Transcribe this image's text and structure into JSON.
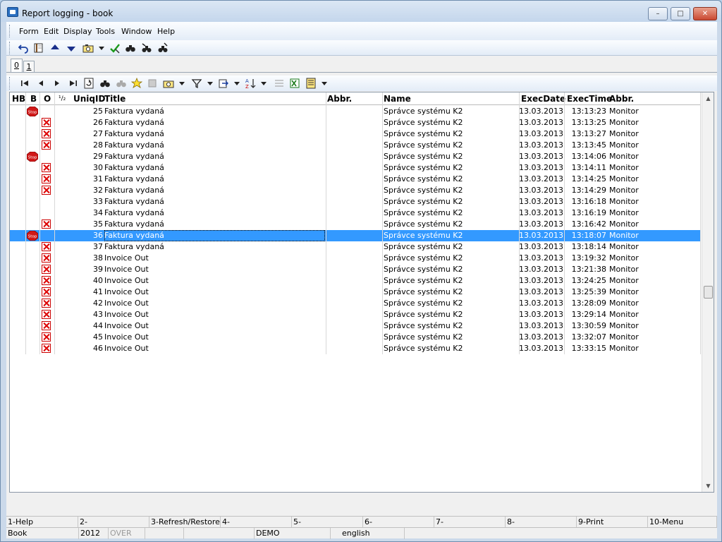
{
  "window": {
    "title": "Report logging - book",
    "min_symbol": "–",
    "max_symbol": "□",
    "close_symbol": "✕"
  },
  "menu": [
    "Form",
    "Edit",
    "Display",
    "Tools",
    "Window",
    "Help"
  ],
  "tabs": [
    "0",
    "1"
  ],
  "grid": {
    "headers": {
      "hb": "HB",
      "b": "B",
      "o": "O",
      "sort": "¹/₂",
      "uniqid": "UniqID",
      "title": "Title",
      "abbr": "Abbr.",
      "name": "Name",
      "execdate": "ExecDate",
      "exectime": "ExecTime",
      "abbr2": "Abbr."
    },
    "rows": [
      {
        "b": "stop",
        "o": "",
        "id": "25",
        "title": "Faktura vydaná",
        "name": "Správce systému K2",
        "date": "13.03.2013",
        "time": "13:13:23",
        "abbr2": "Monitor"
      },
      {
        "b": "",
        "o": "x",
        "id": "26",
        "title": "Faktura vydaná",
        "name": "Správce systému K2",
        "date": "13.03.2013",
        "time": "13:13:25",
        "abbr2": "Monitor"
      },
      {
        "b": "",
        "o": "x",
        "id": "27",
        "title": "Faktura vydaná",
        "name": "Správce systému K2",
        "date": "13.03.2013",
        "time": "13:13:27",
        "abbr2": "Monitor"
      },
      {
        "b": "",
        "o": "x",
        "id": "28",
        "title": "Faktura vydaná",
        "name": "Správce systému K2",
        "date": "13.03.2013",
        "time": "13:13:45",
        "abbr2": "Monitor"
      },
      {
        "b": "stop",
        "o": "",
        "id": "29",
        "title": "Faktura vydaná",
        "name": "Správce systému K2",
        "date": "13.03.2013",
        "time": "13:14:06",
        "abbr2": "Monitor"
      },
      {
        "b": "",
        "o": "x",
        "id": "30",
        "title": "Faktura vydaná",
        "name": "Správce systému K2",
        "date": "13.03.2013",
        "time": "13:14:11",
        "abbr2": "Monitor"
      },
      {
        "b": "",
        "o": "x",
        "id": "31",
        "title": "Faktura vydaná",
        "name": "Správce systému K2",
        "date": "13.03.2013",
        "time": "13:14:25",
        "abbr2": "Monitor"
      },
      {
        "b": "",
        "o": "x",
        "id": "32",
        "title": "Faktura vydaná",
        "name": "Správce systému K2",
        "date": "13.03.2013",
        "time": "13:14:29",
        "abbr2": "Monitor"
      },
      {
        "b": "",
        "o": "",
        "id": "33",
        "title": "Faktura vydaná",
        "name": "Správce systému K2",
        "date": "13.03.2013",
        "time": "13:16:18",
        "abbr2": "Monitor"
      },
      {
        "b": "",
        "o": "",
        "id": "34",
        "title": "Faktura vydaná",
        "name": "Správce systému K2",
        "date": "13.03.2013",
        "time": "13:16:19",
        "abbr2": "Monitor"
      },
      {
        "b": "",
        "o": "x",
        "id": "35",
        "title": "Faktura vydaná",
        "name": "Správce systému K2",
        "date": "13.03.2013",
        "time": "13:16:42",
        "abbr2": "Monitor"
      },
      {
        "b": "stop",
        "o": "",
        "id": "36",
        "title": "Faktura vydaná",
        "name": "Správce systému K2",
        "date": "13.03.2013",
        "time": "13:18:07",
        "abbr2": "Monitor",
        "selected": true
      },
      {
        "b": "",
        "o": "x",
        "id": "37",
        "title": "Faktura vydaná",
        "name": "Správce systému K2",
        "date": "13.03.2013",
        "time": "13:18:14",
        "abbr2": "Monitor"
      },
      {
        "b": "",
        "o": "x",
        "id": "38",
        "title": "Invoice Out",
        "name": "Správce systému K2",
        "date": "13.03.2013",
        "time": "13:19:32",
        "abbr2": "Monitor"
      },
      {
        "b": "",
        "o": "x",
        "id": "39",
        "title": "Invoice Out",
        "name": "Správce systému K2",
        "date": "13.03.2013",
        "time": "13:21:38",
        "abbr2": "Monitor"
      },
      {
        "b": "",
        "o": "x",
        "id": "40",
        "title": "Invoice Out",
        "name": "Správce systému K2",
        "date": "13.03.2013",
        "time": "13:24:25",
        "abbr2": "Monitor"
      },
      {
        "b": "",
        "o": "x",
        "id": "41",
        "title": "Invoice Out",
        "name": "Správce systému K2",
        "date": "13.03.2013",
        "time": "13:25:39",
        "abbr2": "Monitor"
      },
      {
        "b": "",
        "o": "x",
        "id": "42",
        "title": "Invoice Out",
        "name": "Správce systému K2",
        "date": "13.03.2013",
        "time": "13:28:09",
        "abbr2": "Monitor"
      },
      {
        "b": "",
        "o": "x",
        "id": "43",
        "title": "Invoice Out",
        "name": "Správce systému K2",
        "date": "13.03.2013",
        "time": "13:29:14",
        "abbr2": "Monitor"
      },
      {
        "b": "",
        "o": "x",
        "id": "44",
        "title": "Invoice Out",
        "name": "Správce systému K2",
        "date": "13.03.2013",
        "time": "13:30:59",
        "abbr2": "Monitor"
      },
      {
        "b": "",
        "o": "x",
        "id": "45",
        "title": "Invoice Out",
        "name": "Správce systému K2",
        "date": "13.03.2013",
        "time": "13:32:07",
        "abbr2": "Monitor"
      },
      {
        "b": "",
        "o": "x",
        "id": "46",
        "title": "Invoice Out",
        "name": "Správce systému K2",
        "date": "13.03.2013",
        "time": "13:33:15",
        "abbr2": "Monitor"
      }
    ],
    "stop_label": "Stop",
    "selection_color": "#3399ff"
  },
  "function_keys": [
    "1-Help",
    "2-",
    "3-Refresh/Restore",
    "4-",
    "5-",
    "6-",
    "7-",
    "8-",
    "9-Print",
    "10-Menu"
  ],
  "status": {
    "book": "Book",
    "year": "2012",
    "over": "OVER",
    "demo": "DEMO",
    "language": "english"
  }
}
